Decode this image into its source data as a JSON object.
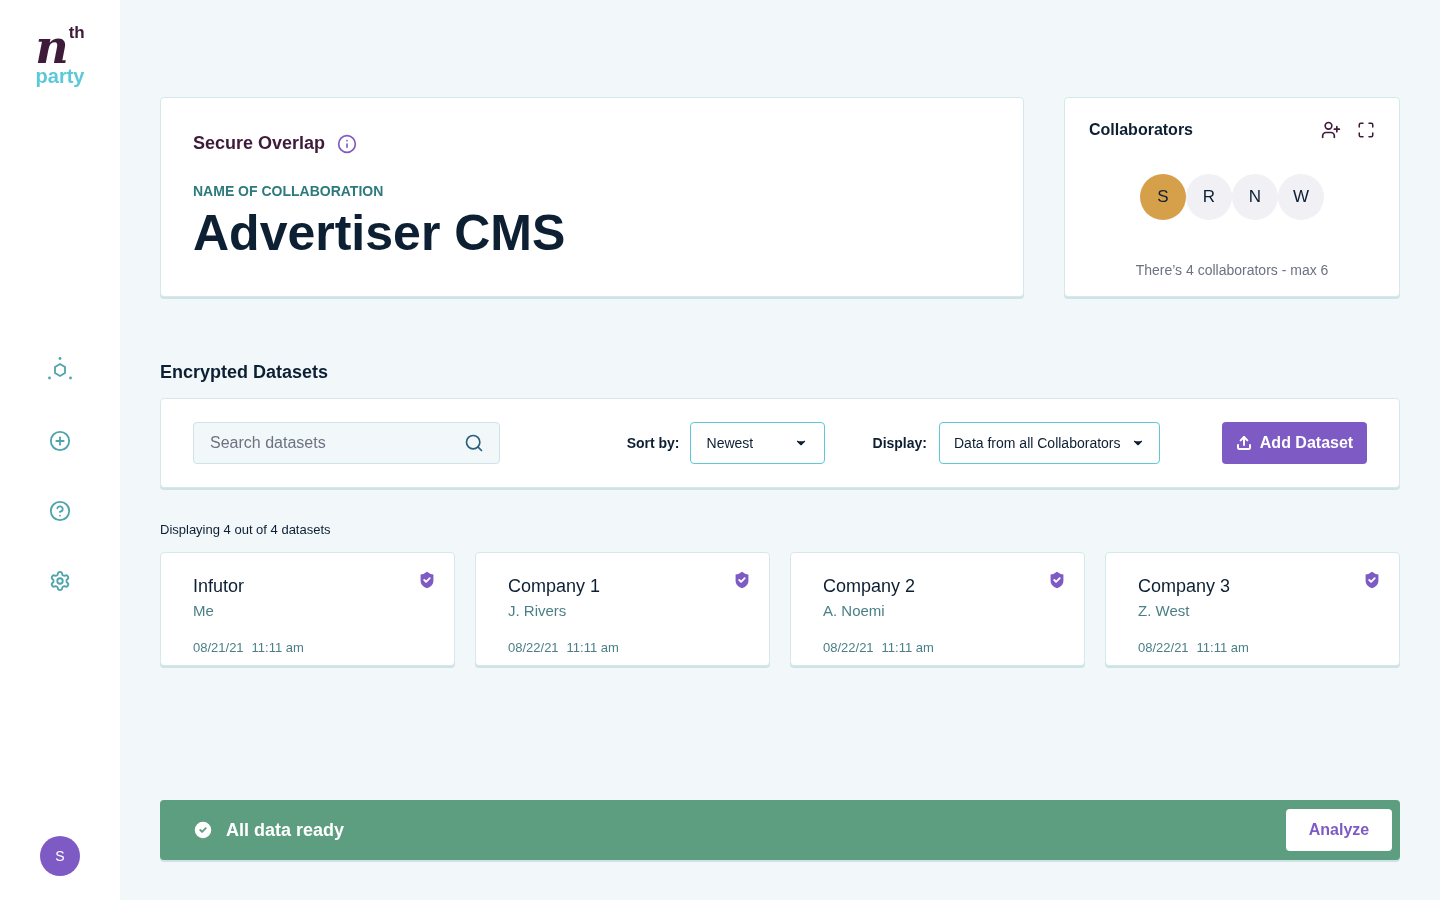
{
  "logo": {
    "main": "n",
    "superscript": "th",
    "sub": "party"
  },
  "user_avatar": "S",
  "overview": {
    "product": "Secure Overlap",
    "label": "NAME OF COLLABORATION",
    "name": "Advertiser CMS"
  },
  "collaborators": {
    "title": "Collaborators",
    "avatars": [
      {
        "initial": "S",
        "color": "#d6a04a"
      },
      {
        "initial": "R",
        "color": "#f0f0f5"
      },
      {
        "initial": "N",
        "color": "#f0f0f5"
      },
      {
        "initial": "W",
        "color": "#f0f0f5"
      }
    ],
    "note": "There’s 4 collaborators - max 6"
  },
  "datasets": {
    "title": "Encrypted Datasets",
    "search": {
      "placeholder": "Search datasets"
    },
    "sort": {
      "label": "Sort by:",
      "value": "Newest"
    },
    "display": {
      "label": "Display:",
      "value": "Data from all Collaborators"
    },
    "add_button": "Add Dataset",
    "count": "Displaying 4 out of 4 datasets",
    "items": [
      {
        "name": "Infutor",
        "owner": "Me",
        "date": "08/21/21",
        "time": "11:11 am",
        "verified": true
      },
      {
        "name": "Company 1",
        "owner": "J. Rivers",
        "date": "08/22/21",
        "time": "11:11 am",
        "verified": true
      },
      {
        "name": "Company 2",
        "owner": "A. Noemi",
        "date": "08/22/21",
        "time": "11:11 am",
        "verified": true
      },
      {
        "name": "Company 3",
        "owner": "Z. West",
        "date": "08/22/21",
        "time": "11:11 am",
        "verified": true
      }
    ]
  },
  "status_bar": {
    "message": "All data ready",
    "button": "Analyze"
  }
}
